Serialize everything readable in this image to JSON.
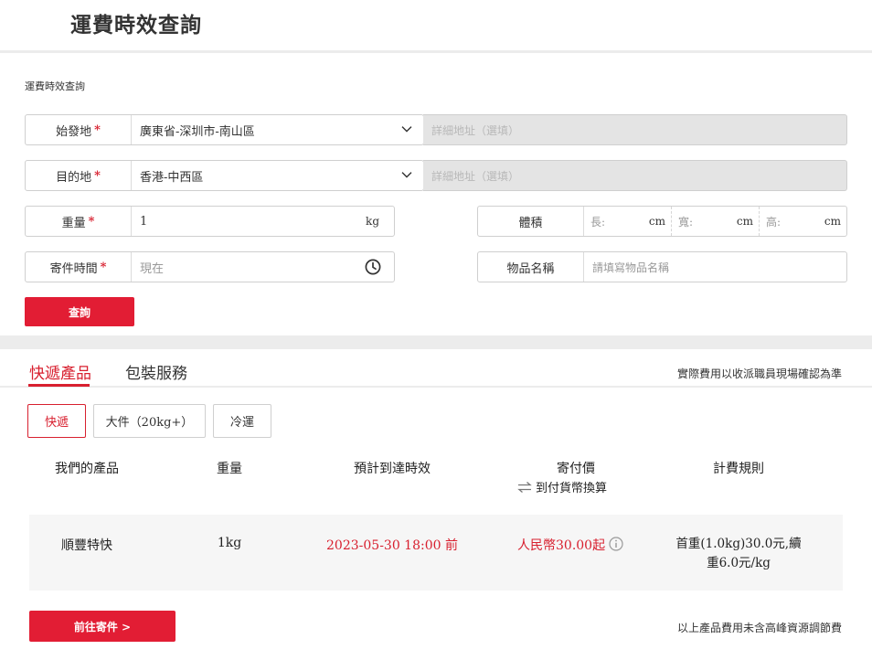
{
  "page": {
    "title": "運費時效查詢"
  },
  "form": {
    "section_label": "運費時效查詢",
    "origin": {
      "label": "始發地",
      "required_mark": "*",
      "value": "廣東省-深圳市-南山區",
      "detail_placeholder": "詳細地址（選填）"
    },
    "destination": {
      "label": "目的地",
      "required_mark": "*",
      "value": "香港-中西區",
      "detail_placeholder": "詳細地址（選填）"
    },
    "weight": {
      "label": "重量",
      "required_mark": "*",
      "value": "1",
      "unit": "kg"
    },
    "volume": {
      "label": "體積",
      "length_placeholder": "長:",
      "width_placeholder": "寬:",
      "height_placeholder": "高:",
      "unit": "cm"
    },
    "send_time": {
      "label": "寄件時間",
      "required_mark": "*",
      "placeholder": "現在"
    },
    "item_name": {
      "label": "物品名稱",
      "placeholder": "請填寫物品名稱"
    },
    "query_button": "查詢"
  },
  "tabs": {
    "items": [
      {
        "label": "快遞產品",
        "active": true
      },
      {
        "label": "包裝服務",
        "active": false
      }
    ],
    "note": "實際費用以收派職員現場確認為準"
  },
  "categories": [
    {
      "label": "快遞",
      "active": true
    },
    {
      "label": "大件（20kg+）",
      "active": false
    },
    {
      "label": "冷運",
      "active": false
    }
  ],
  "table": {
    "headers": {
      "product": "我們的產品",
      "weight": "重量",
      "eta": "預計到達時效",
      "price": "寄付價",
      "price_sub": "到付貨幣換算",
      "rule": "計費規則"
    },
    "rows": [
      {
        "product": "順豐特快",
        "weight": "1kg",
        "eta": "2023-05-30 18:00 前",
        "price": "人民幣30.00起",
        "rule_line1": "首重(1.0kg)30.0元,續",
        "rule_line2": "重6.0元/kg"
      }
    ]
  },
  "footer": {
    "ship_button": "前往寄件 >",
    "note": "以上產品費用未含高峰資源調節費"
  },
  "colors": {
    "accent": "#e21d34",
    "active_text": "#d8202f",
    "disabled_bg": "#e4e4e4"
  }
}
